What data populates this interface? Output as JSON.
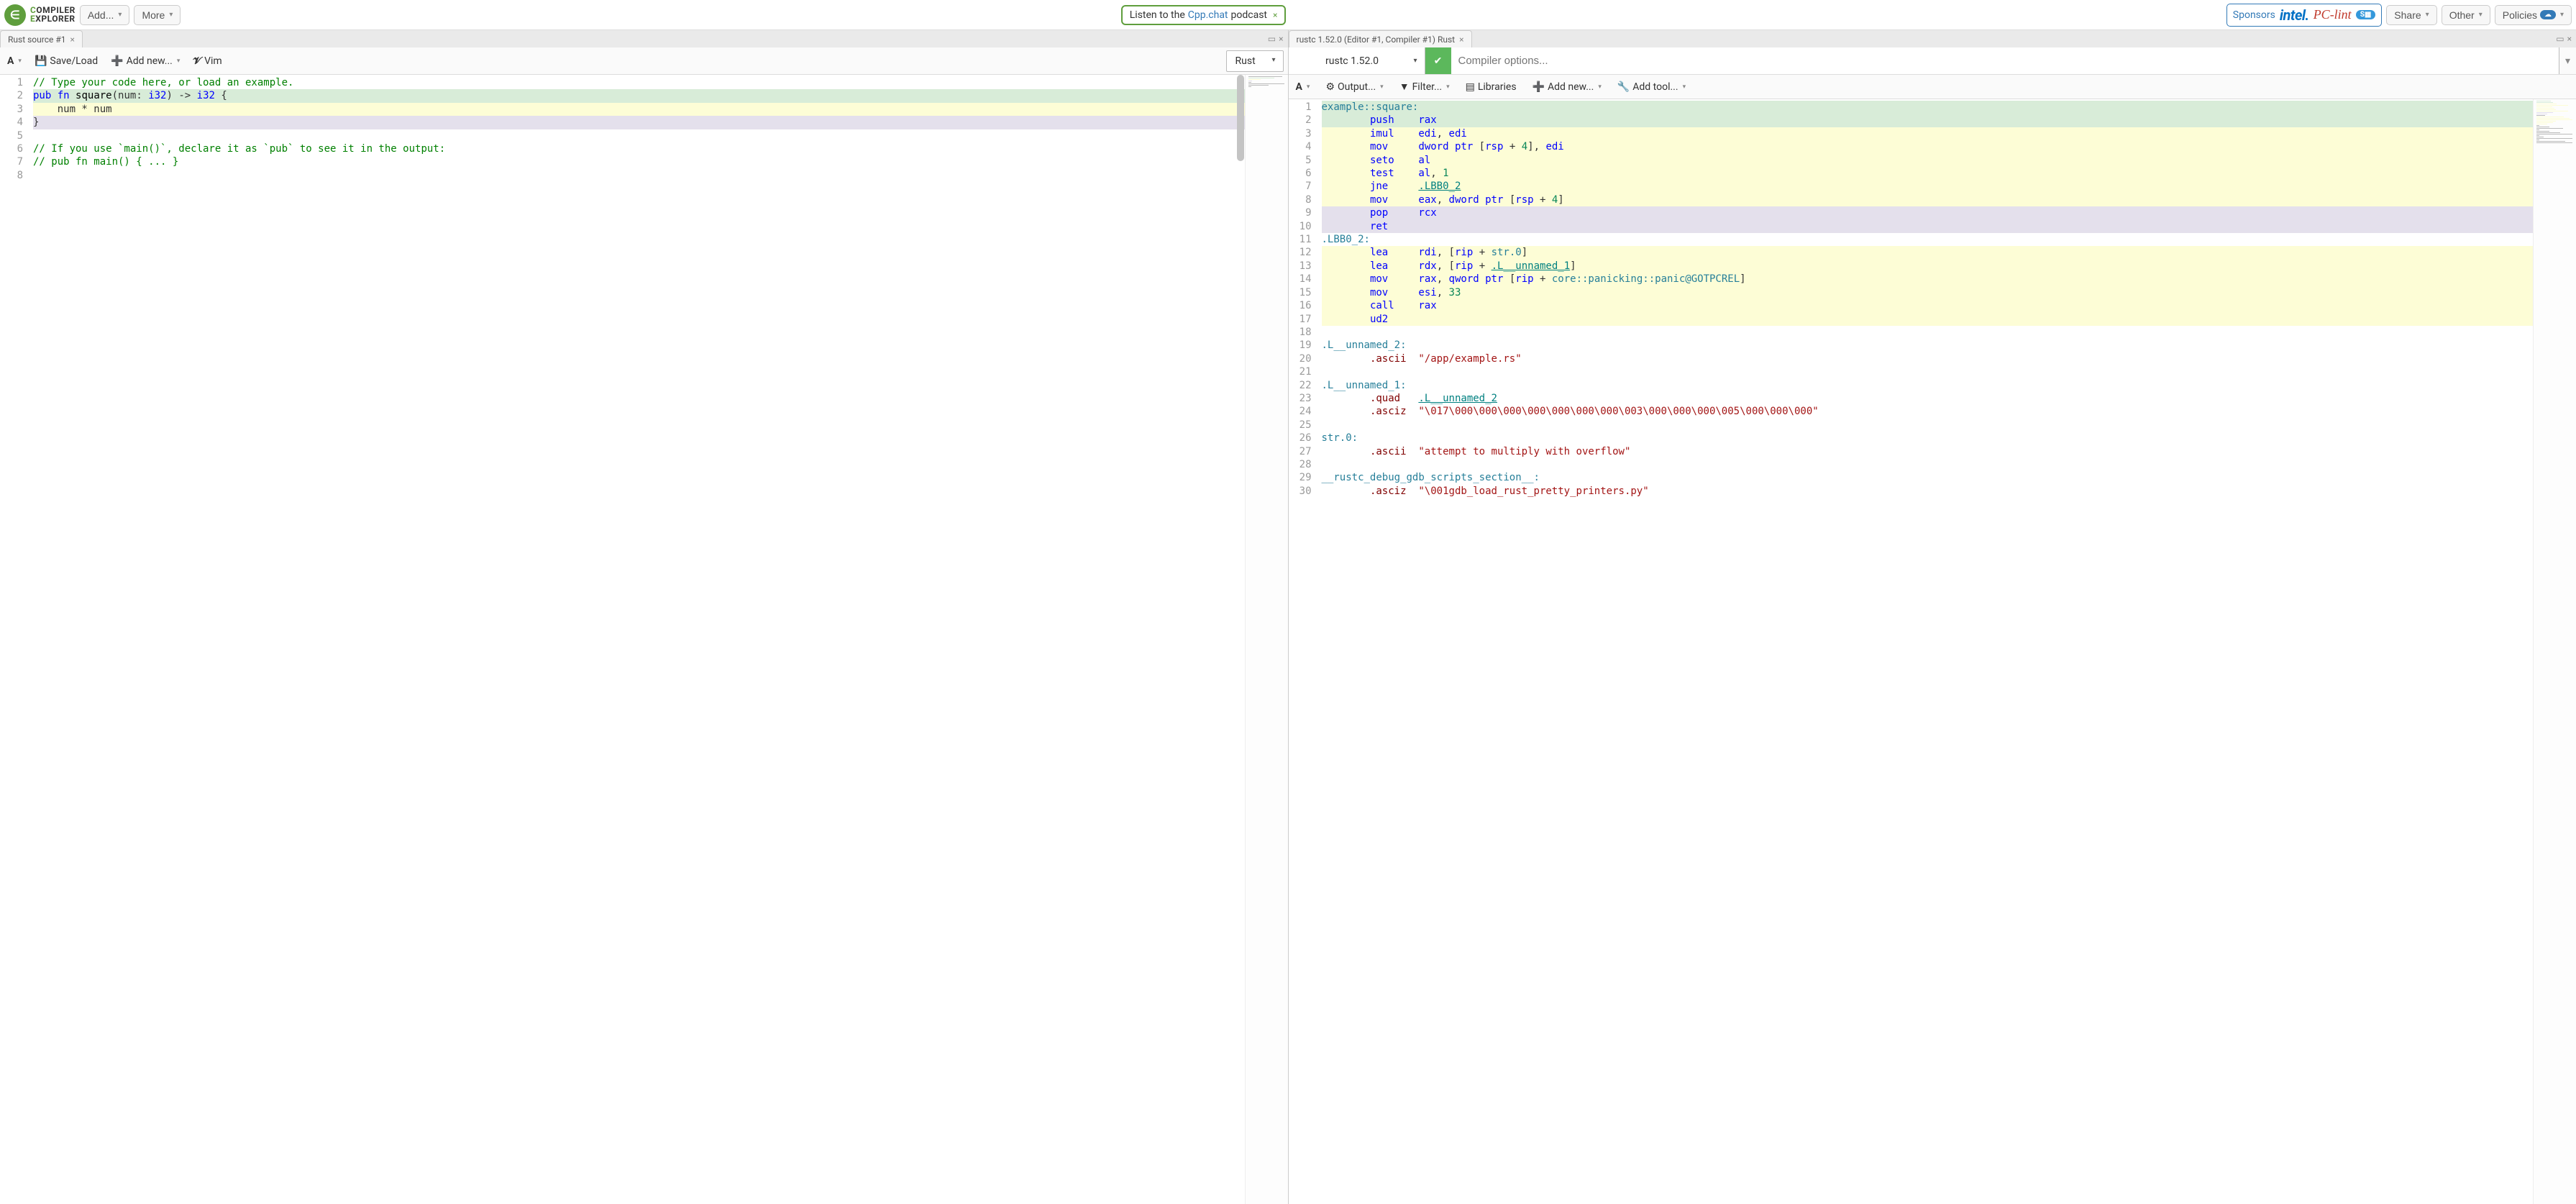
{
  "topbar": {
    "add_label": "Add...",
    "more_label": "More",
    "banner_pre": "Listen to the ",
    "banner_link": "Cpp.chat",
    "banner_post": " podcast",
    "sponsors_label": "Sponsors",
    "share_label": "Share",
    "other_label": "Other",
    "policies_label": "Policies"
  },
  "left": {
    "tab_title": "Rust source #1",
    "toolbar": {
      "save_load": "Save/Load",
      "add_new": "Add new...",
      "vim": "Vim"
    },
    "lang_selected": "Rust",
    "lines": [
      {
        "n": 1,
        "hl": "",
        "tokens": [
          [
            "cm-comment",
            "// Type your code here, or load an example."
          ]
        ]
      },
      {
        "n": 2,
        "hl": "hl-green",
        "tokens": [
          [
            "cm-keyword",
            "pub"
          ],
          [
            "",
            " "
          ],
          [
            "cm-keyword",
            "fn"
          ],
          [
            "",
            " "
          ],
          [
            "cm-fn",
            "square"
          ],
          [
            "",
            "(num: "
          ],
          [
            "cm-keyword",
            "i32"
          ],
          [
            "",
            ") -> "
          ],
          [
            "cm-keyword",
            "i32"
          ],
          [
            "",
            " {"
          ]
        ]
      },
      {
        "n": 3,
        "hl": "hl-yellow",
        "tokens": [
          [
            "",
            "    num * num"
          ]
        ]
      },
      {
        "n": 4,
        "hl": "hl-lav",
        "tokens": [
          [
            "",
            "}"
          ]
        ]
      },
      {
        "n": 5,
        "hl": "",
        "tokens": []
      },
      {
        "n": 6,
        "hl": "",
        "tokens": [
          [
            "cm-comment",
            "// If you use `main()`, declare it as `pub` to see it in the output:"
          ]
        ]
      },
      {
        "n": 7,
        "hl": "",
        "tokens": [
          [
            "cm-comment",
            "// pub fn main() { ... }"
          ]
        ]
      },
      {
        "n": 8,
        "hl": "",
        "tokens": []
      }
    ]
  },
  "right": {
    "tab_title": "rustc 1.52.0 (Editor #1, Compiler #1) Rust",
    "compiler_selected": "rustc 1.52.0",
    "options_placeholder": "Compiler options...",
    "toolbar": {
      "output": "Output...",
      "filter": "Filter...",
      "libraries": "Libraries",
      "add_new": "Add new...",
      "add_tool": "Add tool..."
    },
    "lines": [
      {
        "n": 1,
        "hl": "hl-green",
        "tokens": [
          [
            "cm-label",
            "example::square:"
          ]
        ]
      },
      {
        "n": 2,
        "hl": "hl-green",
        "tokens": [
          [
            "",
            "        "
          ],
          [
            "cm-keyword",
            "push"
          ],
          [
            "",
            "    "
          ],
          [
            "cm-reg",
            "rax"
          ]
        ]
      },
      {
        "n": 3,
        "hl": "hl-yellow",
        "tokens": [
          [
            "",
            "        "
          ],
          [
            "cm-keyword",
            "imul"
          ],
          [
            "",
            "    "
          ],
          [
            "cm-reg",
            "edi"
          ],
          [
            "",
            ", "
          ],
          [
            "cm-reg",
            "edi"
          ]
        ]
      },
      {
        "n": 4,
        "hl": "hl-yellow",
        "tokens": [
          [
            "",
            "        "
          ],
          [
            "cm-keyword",
            "mov"
          ],
          [
            "",
            "     "
          ],
          [
            "cm-reg",
            "dword ptr"
          ],
          [
            "",
            " ["
          ],
          [
            "cm-reg",
            "rsp"
          ],
          [
            "",
            " + "
          ],
          [
            "cm-num",
            "4"
          ],
          [
            "",
            "], "
          ],
          [
            "cm-reg",
            "edi"
          ]
        ]
      },
      {
        "n": 5,
        "hl": "hl-yellow",
        "tokens": [
          [
            "",
            "        "
          ],
          [
            "cm-keyword",
            "seto"
          ],
          [
            "",
            "    "
          ],
          [
            "cm-reg",
            "al"
          ]
        ]
      },
      {
        "n": 6,
        "hl": "hl-yellow",
        "tokens": [
          [
            "",
            "        "
          ],
          [
            "cm-keyword",
            "test"
          ],
          [
            "",
            "    "
          ],
          [
            "cm-reg",
            "al"
          ],
          [
            "",
            ", "
          ],
          [
            "cm-num",
            "1"
          ]
        ]
      },
      {
        "n": 7,
        "hl": "hl-yellow",
        "tokens": [
          [
            "",
            "        "
          ],
          [
            "cm-keyword",
            "jne"
          ],
          [
            "",
            "     "
          ],
          [
            "cm-link",
            ".LBB0_2"
          ]
        ]
      },
      {
        "n": 8,
        "hl": "hl-yellow",
        "tokens": [
          [
            "",
            "        "
          ],
          [
            "cm-keyword",
            "mov"
          ],
          [
            "",
            "     "
          ],
          [
            "cm-reg",
            "eax"
          ],
          [
            "",
            ", "
          ],
          [
            "cm-reg",
            "dword ptr"
          ],
          [
            "",
            " ["
          ],
          [
            "cm-reg",
            "rsp"
          ],
          [
            "",
            " + "
          ],
          [
            "cm-num",
            "4"
          ],
          [
            "",
            "]"
          ]
        ]
      },
      {
        "n": 9,
        "hl": "hl-lav",
        "tokens": [
          [
            "",
            "        "
          ],
          [
            "cm-keyword",
            "pop"
          ],
          [
            "",
            "     "
          ],
          [
            "cm-reg",
            "rcx"
          ]
        ]
      },
      {
        "n": 10,
        "hl": "hl-lav",
        "tokens": [
          [
            "",
            "        "
          ],
          [
            "cm-keyword",
            "ret"
          ]
        ]
      },
      {
        "n": 11,
        "hl": "",
        "tokens": [
          [
            "cm-label",
            ".LBB0_2:"
          ]
        ]
      },
      {
        "n": 12,
        "hl": "hl-yellow",
        "tokens": [
          [
            "",
            "        "
          ],
          [
            "cm-keyword",
            "lea"
          ],
          [
            "",
            "     "
          ],
          [
            "cm-reg",
            "rdi"
          ],
          [
            "",
            ", ["
          ],
          [
            "cm-reg",
            "rip"
          ],
          [
            "",
            " + "
          ],
          [
            "cm-label",
            "str.0"
          ],
          [
            "",
            "]"
          ]
        ]
      },
      {
        "n": 13,
        "hl": "hl-yellow",
        "tokens": [
          [
            "",
            "        "
          ],
          [
            "cm-keyword",
            "lea"
          ],
          [
            "",
            "     "
          ],
          [
            "cm-reg",
            "rdx"
          ],
          [
            "",
            ", ["
          ],
          [
            "cm-reg",
            "rip"
          ],
          [
            "",
            " + "
          ],
          [
            "cm-link",
            ".L__unnamed_1"
          ],
          [
            "",
            "]"
          ]
        ]
      },
      {
        "n": 14,
        "hl": "hl-yellow",
        "tokens": [
          [
            "",
            "        "
          ],
          [
            "cm-keyword",
            "mov"
          ],
          [
            "",
            "     "
          ],
          [
            "cm-reg",
            "rax"
          ],
          [
            "",
            ", "
          ],
          [
            "cm-reg",
            "qword ptr"
          ],
          [
            "",
            " ["
          ],
          [
            "cm-reg",
            "rip"
          ],
          [
            "",
            " + "
          ],
          [
            "cm-label",
            "core::panicking::panic@GOTPCREL"
          ],
          [
            "",
            "]"
          ]
        ]
      },
      {
        "n": 15,
        "hl": "hl-yellow",
        "tokens": [
          [
            "",
            "        "
          ],
          [
            "cm-keyword",
            "mov"
          ],
          [
            "",
            "     "
          ],
          [
            "cm-reg",
            "esi"
          ],
          [
            "",
            ", "
          ],
          [
            "cm-num",
            "33"
          ]
        ]
      },
      {
        "n": 16,
        "hl": "hl-yellow",
        "tokens": [
          [
            "",
            "        "
          ],
          [
            "cm-keyword",
            "call"
          ],
          [
            "",
            "    "
          ],
          [
            "cm-reg",
            "rax"
          ]
        ]
      },
      {
        "n": 17,
        "hl": "hl-yellow",
        "tokens": [
          [
            "",
            "        "
          ],
          [
            "cm-keyword",
            "ud2"
          ]
        ]
      },
      {
        "n": 18,
        "hl": "",
        "tokens": []
      },
      {
        "n": 19,
        "hl": "",
        "tokens": [
          [
            "cm-label",
            ".L__unnamed_2:"
          ]
        ]
      },
      {
        "n": 20,
        "hl": "",
        "tokens": [
          [
            "",
            "        "
          ],
          [
            "cm-dir",
            ".ascii"
          ],
          [
            "",
            "  "
          ],
          [
            "cm-str",
            "\"/app/example.rs\""
          ]
        ]
      },
      {
        "n": 21,
        "hl": "",
        "tokens": []
      },
      {
        "n": 22,
        "hl": "",
        "tokens": [
          [
            "cm-label",
            ".L__unnamed_1:"
          ]
        ]
      },
      {
        "n": 23,
        "hl": "",
        "tokens": [
          [
            "",
            "        "
          ],
          [
            "cm-dir",
            ".quad"
          ],
          [
            "",
            "   "
          ],
          [
            "cm-link",
            ".L__unnamed_2"
          ]
        ]
      },
      {
        "n": 24,
        "hl": "",
        "tokens": [
          [
            "",
            "        "
          ],
          [
            "cm-dir",
            ".asciz"
          ],
          [
            "",
            "  "
          ],
          [
            "cm-str",
            "\"\\017\\000\\000\\000\\000\\000\\000\\000\\003\\000\\000\\000\\005\\000\\000\\000\""
          ]
        ]
      },
      {
        "n": 25,
        "hl": "",
        "tokens": []
      },
      {
        "n": 26,
        "hl": "",
        "tokens": [
          [
            "cm-label",
            "str.0:"
          ]
        ]
      },
      {
        "n": 27,
        "hl": "",
        "tokens": [
          [
            "",
            "        "
          ],
          [
            "cm-dir",
            ".ascii"
          ],
          [
            "",
            "  "
          ],
          [
            "cm-str",
            "\"attempt to multiply with overflow\""
          ]
        ]
      },
      {
        "n": 28,
        "hl": "",
        "tokens": []
      },
      {
        "n": 29,
        "hl": "",
        "tokens": [
          [
            "cm-label",
            "__rustc_debug_gdb_scripts_section__:"
          ]
        ]
      },
      {
        "n": 30,
        "hl": "",
        "tokens": [
          [
            "",
            "        "
          ],
          [
            "cm-dir",
            ".asciz"
          ],
          [
            "",
            "  "
          ],
          [
            "cm-str",
            "\"\\001gdb_load_rust_pretty_printers.py\""
          ]
        ]
      }
    ]
  }
}
